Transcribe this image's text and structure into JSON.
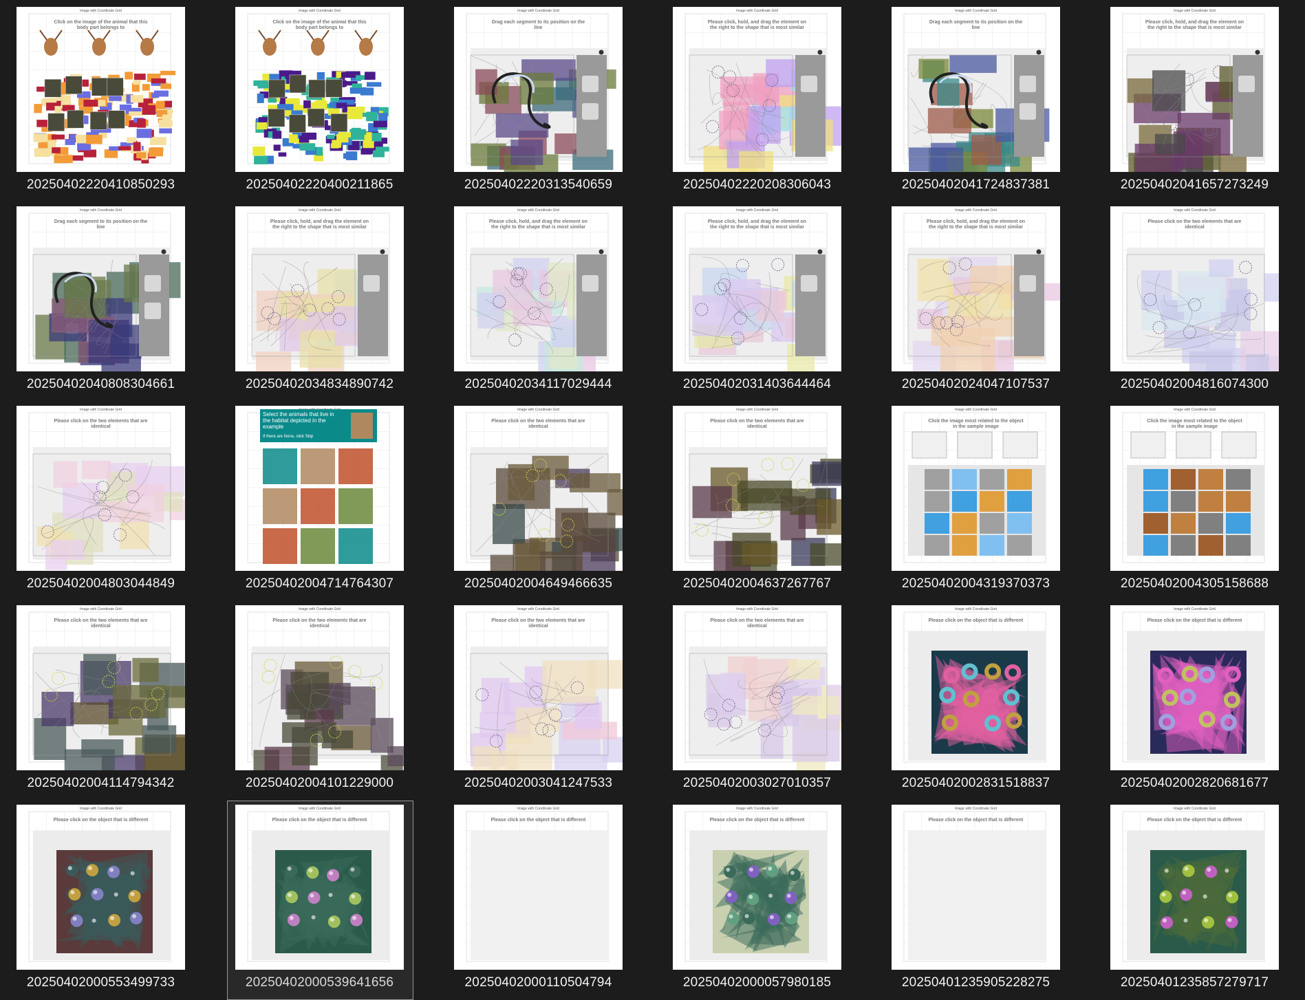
{
  "colors": {
    "background": "#1c1c1c",
    "thumbnail_bg": "#ffffff",
    "caption": "#f2f2f2",
    "selection_border": "#9a9a9a"
  },
  "grid_header": "Image with Coordinate Grid",
  "tiles": [
    {
      "filename": "20250402220410850293",
      "instruction": "Click on the image of the animal that this body part belongs to",
      "kind": "animals",
      "palette": [
        "#b8213a",
        "#f29b38",
        "#6a6ee0",
        "#f5e0a0"
      ]
    },
    {
      "filename": "20250402220400211865",
      "instruction": "Click on the image of the animal that this body part belongs to",
      "kind": "animals",
      "palette": [
        "#4a1a8a",
        "#2fb39a",
        "#e8e83a",
        "#3a7ad0"
      ]
    },
    {
      "filename": "20250402220313540659",
      "instruction": "Drag each segment to its position on the line",
      "kind": "segments",
      "palette": [
        "#5a4a8a",
        "#6a7a3a",
        "#8a4a5a",
        "#3a6a7a"
      ]
    },
    {
      "filename": "20250402220208306043",
      "instruction": "Please click, hold, and drag the element on the right to the shape that is most similar",
      "kind": "shapes_bright",
      "palette": [
        "#f0a0c0",
        "#a0e0f0",
        "#f0e080",
        "#c0a0f0"
      ]
    },
    {
      "filename": "20250402041724837381",
      "instruction": "Drag each segment to its position on the line",
      "kind": "segments",
      "palette": [
        "#4a5aa0",
        "#7a8a3a",
        "#a05a4a",
        "#3a8a8a"
      ]
    },
    {
      "filename": "20250402041657273249",
      "instruction": "Please click, hold, and drag the element on the right to the shape that is most similar",
      "kind": "shapes_dark",
      "palette": [
        "#5a5a2a",
        "#6a3a6a",
        "#4a4a4a",
        "#7a6a3a"
      ]
    },
    {
      "filename": "20250402040808304661",
      "instruction": "Drag each segment to its position on the line",
      "kind": "segments",
      "palette": [
        "#3a3a7a",
        "#6a7a4a",
        "#8a5a7a",
        "#4a6a5a"
      ]
    },
    {
      "filename": "20250402034834890742",
      "instruction": "Please click, hold, and drag the element on the right to the shape that is most similar",
      "kind": "pastel_drag",
      "palette": [
        "#e8e0a8",
        "#e0c8e8",
        "#c8e0e8",
        "#f0d0c0"
      ]
    },
    {
      "filename": "20250402034117029444",
      "instruction": "Please click, hold, and drag the element on the right to the shape that is most similar",
      "kind": "pastel_drag",
      "palette": [
        "#c8e8e0",
        "#e8c8e0",
        "#e0e8c8",
        "#d0d0f0"
      ]
    },
    {
      "filename": "20250402031403644464",
      "instruction": "Please click, hold, and drag the element on the right to the shape that is most similar",
      "kind": "pastel_drag",
      "palette": [
        "#d8c8f0",
        "#e8e8a8",
        "#c8d8f0",
        "#e8c8d8"
      ]
    },
    {
      "filename": "20250402024047107537",
      "instruction": "Please click, hold, and drag the element on the right to the shape that is most similar",
      "kind": "pastel_drag",
      "palette": [
        "#f0e0a8",
        "#e8c8e0",
        "#f0d0b0",
        "#e0d8f0"
      ]
    },
    {
      "filename": "20250402004816074300",
      "instruction": "Please click on the two elements that are identical",
      "kind": "pastel_identical",
      "palette": [
        "#d0d0f0",
        "#e8d0e8",
        "#d8e8f0",
        "#c8c8e8"
      ]
    },
    {
      "filename": "20250402004803044849",
      "instruction": "Please click on the two elements that are identical",
      "kind": "pastel_identical",
      "palette": [
        "#f0e0b0",
        "#e8d0f0",
        "#e0e0c0",
        "#f0d0e0"
      ]
    },
    {
      "filename": "20250402004714764307",
      "instruction": "Select the animals that live in the habitat depicted in the example",
      "kind": "habitat",
      "sub_instruction": "If there are None, click Skip",
      "palette": [
        "#0b8a8a",
        "#b08860",
        "#c0502a",
        "#6a8a3a"
      ]
    },
    {
      "filename": "20250402004649466635",
      "instruction": "Please click on the two elements that are identical",
      "kind": "dark_identical",
      "palette": [
        "#5a4a3a",
        "#4a3a5a",
        "#6a5a3a",
        "#3a4a4a"
      ]
    },
    {
      "filename": "20250402004637267767",
      "instruction": "Please click on the two elements that are identical",
      "kind": "dark_identical",
      "palette": [
        "#4a4a2a",
        "#5a3a4a",
        "#6a5a2a",
        "#3a3a5a"
      ]
    },
    {
      "filename": "20250402004319370373",
      "instruction": "Click the image most related to the object in the sample image",
      "kind": "related",
      "palette": [
        "#40a0e0",
        "#e0a040",
        "#a0a0a0",
        "#80c0f0"
      ]
    },
    {
      "filename": "20250402004305158688",
      "instruction": "Click the image most related to the object in the sample image",
      "kind": "related",
      "palette": [
        "#808080",
        "#40a0e0",
        "#c08040",
        "#a06030"
      ]
    },
    {
      "filename": "20250402004114794342",
      "instruction": "Please click on the two elements that are identical",
      "kind": "dark_identical",
      "palette": [
        "#5a4a2a",
        "#4a3a6a",
        "#6a6a3a",
        "#4a5a5a"
      ]
    },
    {
      "filename": "20250402004101229000",
      "instruction": "Please click on the two elements that are identical",
      "kind": "dark_identical",
      "palette": [
        "#5a4a5a",
        "#6a5a3a",
        "#4a4a3a",
        "#5a3a4a"
      ]
    },
    {
      "filename": "20250402003041247533",
      "instruction": "Please click on the two elements that are identical",
      "kind": "pastel_tiles",
      "palette": [
        "#f0c8d8",
        "#d8d0f0",
        "#f0e0c0",
        "#e0c8f0"
      ]
    },
    {
      "filename": "20250402003027010357",
      "instruction": "Please click on the two elements that are identical",
      "kind": "pastel_tiles",
      "palette": [
        "#f0d0d0",
        "#e0d0f0",
        "#f0e8c0",
        "#d8c8e8"
      ]
    },
    {
      "filename": "20250402002831518837",
      "instruction": "Please click on the object that is different",
      "kind": "donuts",
      "palette": [
        "#1a3a4a",
        "#e060a0",
        "#60c0d0",
        "#c0a040"
      ]
    },
    {
      "filename": "20250402002820681677",
      "instruction": "Please click on the object that is different",
      "kind": "donuts",
      "palette": [
        "#2a2a5a",
        "#e060c0",
        "#c0c060",
        "#a0a0e0"
      ]
    },
    {
      "filename": "20250402000553499733",
      "instruction": "Please click on the object that is different",
      "kind": "spheres",
      "palette": [
        "#5a3a3a",
        "#3a5a5a",
        "#c0a040",
        "#8080c0"
      ]
    },
    {
      "filename": "20250402000539641656",
      "instruction": "Please click on the object that is different",
      "kind": "spheres",
      "palette": [
        "#2a5a4a",
        "#3a6a5a",
        "#a0c060",
        "#c080c0"
      ],
      "selected": true
    },
    {
      "filename": "20250402000110504794",
      "instruction": "Please click on the object that is different",
      "kind": "blank",
      "palette": [
        "#f4f4f4",
        "#f4f4f4",
        "#f4f4f4",
        "#f4f4f4"
      ]
    },
    {
      "filename": "20250402000057980185",
      "instruction": "Please click on the object that is different",
      "kind": "spheres",
      "palette": [
        "#c8d0b0",
        "#3a6a5a",
        "#8060c0",
        "#60a080"
      ]
    },
    {
      "filename": "20250401235905228275",
      "instruction": "Please click on the object that is different",
      "kind": "blank",
      "palette": [
        "#f4f4f4",
        "#f4f4f4",
        "#f4f4f4",
        "#f4f4f4"
      ]
    },
    {
      "filename": "20250401235857279717",
      "instruction": "Please click on the object that is different",
      "kind": "spheres",
      "palette": [
        "#2a5a4a",
        "#4a6a3a",
        "#a0c040",
        "#c060c0"
      ]
    }
  ]
}
